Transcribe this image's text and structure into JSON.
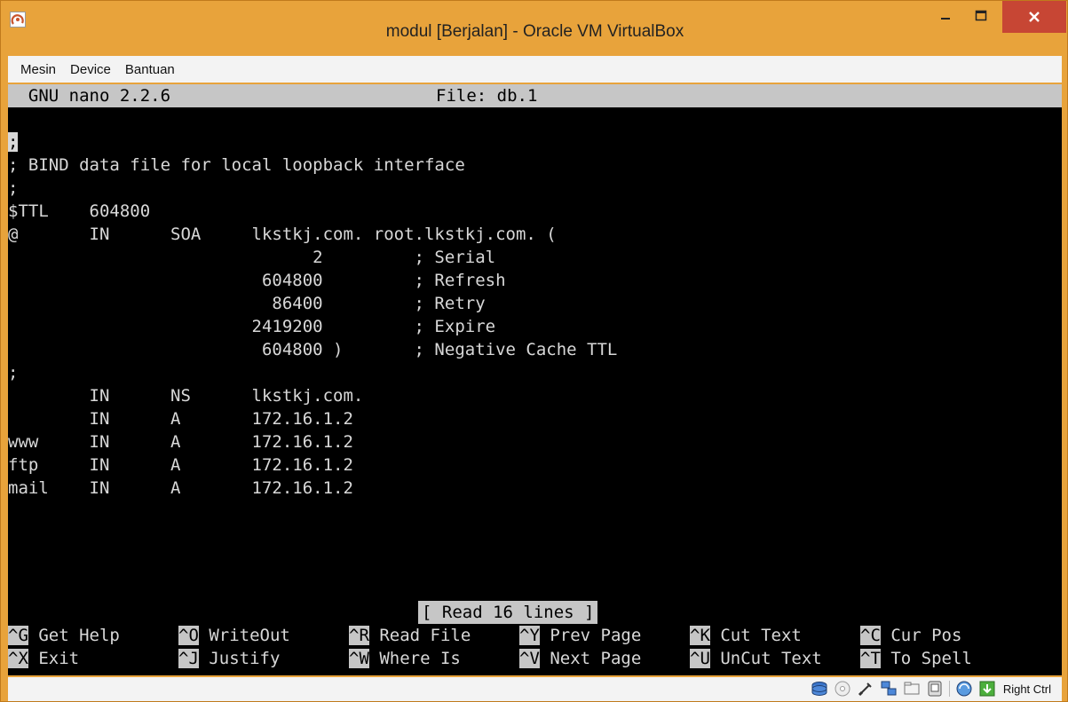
{
  "window": {
    "title": "modul [Berjalan] - Oracle VM VirtualBox",
    "menu": [
      "Mesin",
      "Device",
      "Bantuan"
    ]
  },
  "nano": {
    "version": "  GNU nano 2.2.6",
    "file": "File: db.1",
    "lines": [
      "",
      ";",
      "; BIND data file for local loopback interface",
      ";",
      "$TTL    604800",
      "@       IN      SOA     lkstkj.com. root.lkstkj.com. (",
      "                              2         ; Serial",
      "                         604800         ; Refresh",
      "                          86400         ; Retry",
      "                        2419200         ; Expire",
      "                         604800 )       ; Negative Cache TTL",
      ";",
      "        IN      NS      lkstkj.com.",
      "        IN      A       172.16.1.2",
      "www     IN      A       172.16.1.2",
      "ftp     IN      A       172.16.1.2",
      "mail    IN      A       172.16.1.2"
    ],
    "status": "[ Read 16 lines ]",
    "shortcuts_row1": [
      {
        "key": "^G",
        "label": " Get Help"
      },
      {
        "key": "^O",
        "label": " WriteOut"
      },
      {
        "key": "^R",
        "label": " Read File"
      },
      {
        "key": "^Y",
        "label": " Prev Page"
      },
      {
        "key": "^K",
        "label": " Cut Text"
      },
      {
        "key": "^C",
        "label": " Cur Pos"
      }
    ],
    "shortcuts_row2": [
      {
        "key": "^X",
        "label": " Exit"
      },
      {
        "key": "^J",
        "label": " Justify"
      },
      {
        "key": "^W",
        "label": " Where Is"
      },
      {
        "key": "^V",
        "label": " Next Page"
      },
      {
        "key": "^U",
        "label": " UnCut Text"
      },
      {
        "key": "^T",
        "label": " To Spell"
      }
    ]
  },
  "statusbar": {
    "host_key": "Right Ctrl",
    "icons": [
      "hard-disk-icon",
      "optical-drive-icon",
      "usb-icon",
      "shared-folders-icon",
      "display-icon",
      "video-capture-icon",
      "network-icon",
      "mouse-integration-icon"
    ]
  },
  "colors": {
    "frame": "#e8a33b",
    "close": "#c74634",
    "terminal_bg": "#000000",
    "terminal_fg": "#d8d8d8",
    "highlight_bg": "#c6c6c6"
  }
}
